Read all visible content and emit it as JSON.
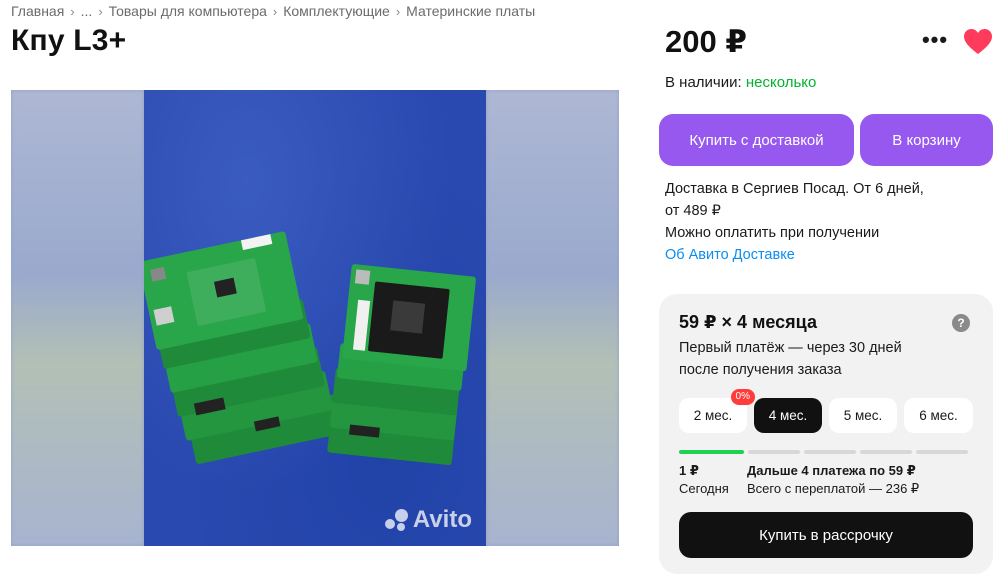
{
  "breadcrumb": [
    "Главная",
    "...",
    "Товары для компьютера",
    "Комплектующие",
    "Материнские платы"
  ],
  "title": "Кпу L3+",
  "gallery": {
    "watermark": "Avito"
  },
  "price": "200 ₽",
  "stock": {
    "label": "В наличии:",
    "value": "несколько"
  },
  "buttons": {
    "delivery": "Купить с доставкой",
    "cart": "В корзину"
  },
  "delivery": {
    "line1": "Доставка в Сергиев Посад. От 6 дней,",
    "line2": "от 489 ₽",
    "line3": "Можно оплатить при получении",
    "link": "Об Авито Доставке"
  },
  "installment": {
    "title": "59 ₽ × 4 месяца",
    "help": "?",
    "desc": "Первый платёж — через 30 дней после получения заказа",
    "terms": [
      {
        "label": "2 мес.",
        "badge": "0%"
      },
      {
        "label": "4 мес.",
        "active": true
      },
      {
        "label": "5 мес."
      },
      {
        "label": "6 мес."
      }
    ],
    "today_amount": "1 ₽",
    "today_label": "Сегодня",
    "rest_title": "Дальше 4 платежа по 59 ₽",
    "rest_sub": "Всего с переплатой — 236 ₽",
    "button": "Купить в рассрочку"
  },
  "colors": {
    "accent": "#9758ef",
    "in_stock": "#02b32b",
    "link": "#0a8ef0",
    "heart": "#ff3b5c"
  }
}
